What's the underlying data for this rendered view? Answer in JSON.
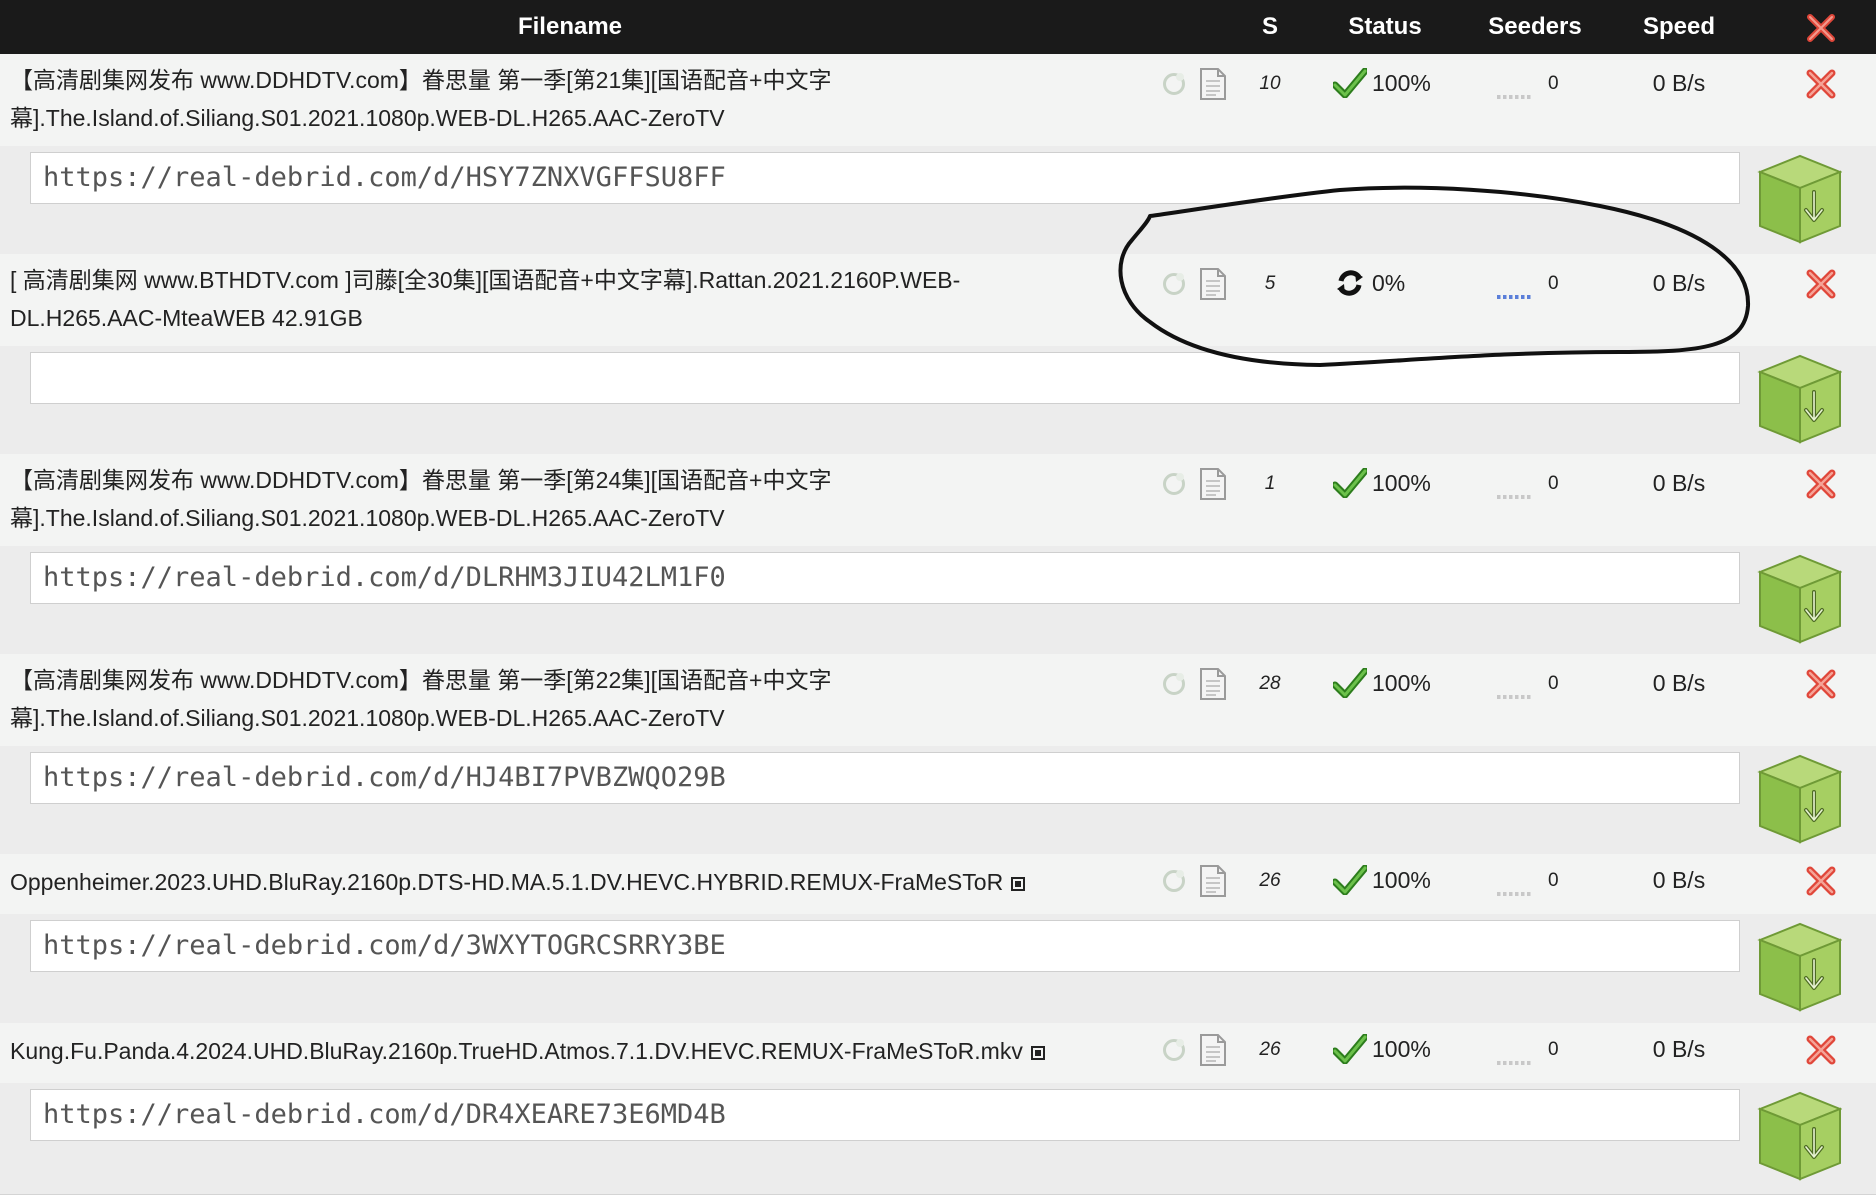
{
  "header": {
    "filename": "Filename",
    "s": "S",
    "status": "Status",
    "seeders": "Seeders",
    "speed": "Speed"
  },
  "colors": {
    "header_bg": "#1a1a1a",
    "check_green": "#3c9a2a",
    "delete_red": "#e0473a",
    "box_green": "#8cbf4a",
    "seeder_active": "#5b7fd9"
  },
  "icons": {
    "progress": "progress-ring-icon",
    "details": "document-icon",
    "done": "checkmark-icon",
    "downloading": "refresh-icon",
    "delete": "delete-x-icon",
    "download": "download-box-icon",
    "stream": "stream-icon"
  },
  "rows": [
    {
      "name_line1": "【高清剧集网发布 www.DDHDTV.com】眷思量 第一季[第21集][国语配音+中文字",
      "name_line2": "幕].The.Island.of.Siliang.S01.2021.1080p.WEB-DL.H265.AAC-ZeroTV",
      "s": "10",
      "status_type": "done",
      "status": "100%",
      "seeders": "0",
      "speed": "0 B/s",
      "link": "https://real-debrid.com/d/HSY7ZNXVGFFSU8FF"
    },
    {
      "name_line1": "[ 高清剧集网 www.BTHDTV.com ]司藤[全30集][国语配音+中文字幕].Rattan.2021.2160P.WEB-",
      "name_line2": "DL.H265.AAC-MteaWEB 42.91GB",
      "s": "5",
      "status_type": "downloading",
      "status": "0%",
      "seeders": "0",
      "speed": "0 B/s",
      "link": ""
    },
    {
      "name_line1": "【高清剧集网发布 www.DDHDTV.com】眷思量 第一季[第24集][国语配音+中文字",
      "name_line2": "幕].The.Island.of.Siliang.S01.2021.1080p.WEB-DL.H265.AAC-ZeroTV",
      "s": "1",
      "status_type": "done",
      "status": "100%",
      "seeders": "0",
      "speed": "0 B/s",
      "link": "https://real-debrid.com/d/DLRHM3JIU42LM1F0"
    },
    {
      "name_line1": "【高清剧集网发布 www.DDHDTV.com】眷思量 第一季[第22集][国语配音+中文字",
      "name_line2": "幕].The.Island.of.Siliang.S01.2021.1080p.WEB-DL.H265.AAC-ZeroTV",
      "s": "28",
      "status_type": "done",
      "status": "100%",
      "seeders": "0",
      "speed": "0 B/s",
      "link": "https://real-debrid.com/d/HJ4BI7PVBZWQO29B"
    },
    {
      "name_line1": "Oppenheimer.2023.UHD.BluRay.2160p.DTS-HD.MA.5.1.DV.HEVC.HYBRID.REMUX-FraMeSToR",
      "name_line2": "",
      "s": "26",
      "status_type": "done",
      "status": "100%",
      "seeders": "0",
      "speed": "0 B/s",
      "link": "https://real-debrid.com/d/3WXYTOGRCSRRY3BE"
    },
    {
      "name_line1": "Kung.Fu.Panda.4.2024.UHD.BluRay.2160p.TrueHD.Atmos.7.1.DV.HEVC.REMUX-FraMeSToR.mkv",
      "name_line2": "",
      "s": "26",
      "status_type": "done",
      "status": "100%",
      "seeders": "0",
      "speed": "0 B/s",
      "link": "https://real-debrid.com/d/DR4XEARE73E6MD4B"
    }
  ]
}
